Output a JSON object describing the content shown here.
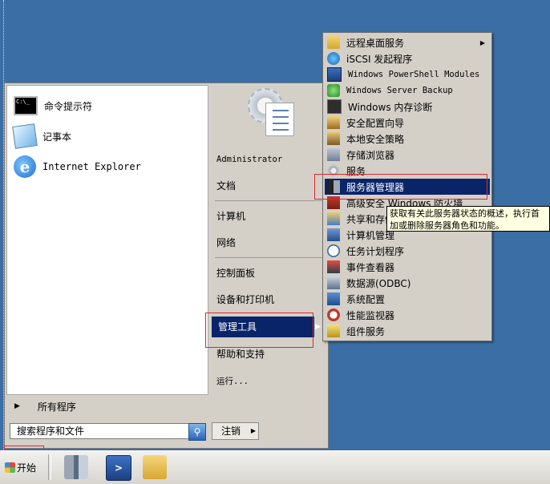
{
  "start_menu": {
    "pinned": [
      {
        "label": "命令提示符",
        "icon": "cmd-icon",
        "mono": false
      },
      {
        "label": "记事本",
        "icon": "notepad-icon",
        "mono": false
      },
      {
        "label": "Internet Explorer",
        "icon": "internet-explorer-icon",
        "mono": true
      }
    ],
    "cmd_icon_text": "C:\\_",
    "all_programs": "所有程序",
    "search_placeholder": "搜索程序和文件",
    "logoff_label": "注销",
    "right_items": {
      "administrator": "Administrator",
      "documents": "文档",
      "computer": "计算机",
      "network": "网络",
      "control_panel": "控制面板",
      "devices_printers": "设备和打印机",
      "admin_tools": "管理工具",
      "help_support": "帮助和支持",
      "run": "运行..."
    }
  },
  "admin_tools_menu": {
    "items": [
      {
        "label": "远程桌面服务",
        "icon": "folder-icon",
        "has_submenu": true
      },
      {
        "label": "iSCSI 发起程序",
        "icon": "globe-icon"
      },
      {
        "label": "Windows PowerShell Modules",
        "icon": "powershell-icon"
      },
      {
        "label": "Windows Server Backup",
        "icon": "backup-icon"
      },
      {
        "label": "Windows 内存诊断",
        "icon": "memory-diagnostic-icon"
      },
      {
        "label": "安全配置向导",
        "icon": "security-wizard-icon"
      },
      {
        "label": "本地安全策略",
        "icon": "local-policy-icon"
      },
      {
        "label": "存储浏览器",
        "icon": "storage-explorer-icon"
      },
      {
        "label": "服务",
        "icon": "services-icon"
      },
      {
        "label": "服务器管理器",
        "icon": "server-manager-icon",
        "selected": true
      },
      {
        "label": "高级安全 Windows 防火墙",
        "icon": "firewall-icon"
      },
      {
        "label": "共享和存储管理",
        "icon": "share-storage-icon"
      },
      {
        "label": "计算机管理",
        "icon": "computer-management-icon"
      },
      {
        "label": "任务计划程序",
        "icon": "task-scheduler-icon"
      },
      {
        "label": "事件查看器",
        "icon": "event-viewer-icon"
      },
      {
        "label": "数据源(ODBC)",
        "icon": "odbc-icon"
      },
      {
        "label": "系统配置",
        "icon": "system-config-icon"
      },
      {
        "label": "性能监视器",
        "icon": "performance-monitor-icon"
      },
      {
        "label": "组件服务",
        "icon": "component-services-icon"
      }
    ]
  },
  "tooltip": {
    "line1": "获取有关此服务器状态的概述，执行首",
    "line2": "加或删除服务器角色和功能。"
  },
  "taskbar": {
    "start_label": "开始"
  },
  "colors": {
    "desktop": "#3a6ea5",
    "menu_bg": "#d4d0c8",
    "selection": "#0a246a",
    "highlight_box": "#e0282d",
    "tooltip_bg": "#ffffe1"
  }
}
